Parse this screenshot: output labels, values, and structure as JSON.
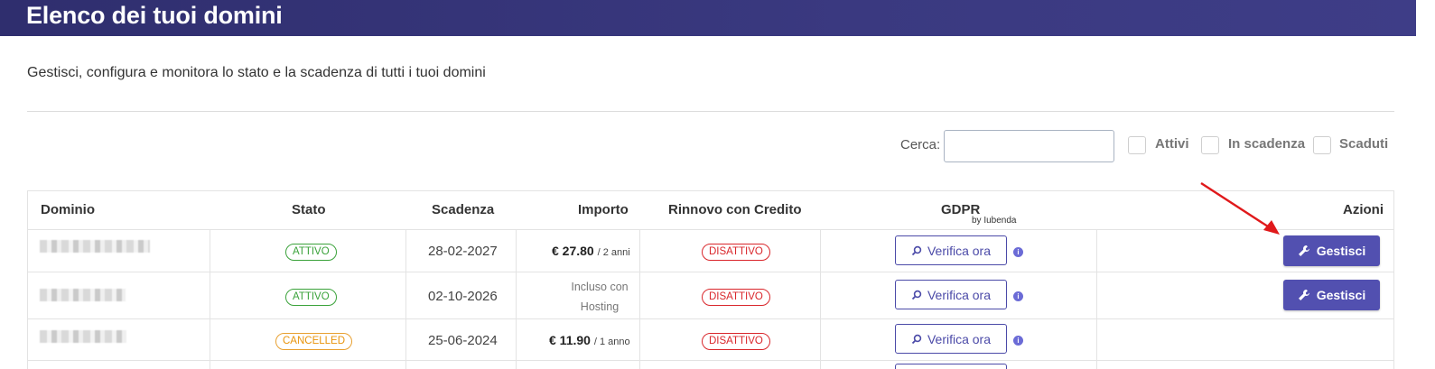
{
  "header": {
    "title": "Elenco dei tuoi domini"
  },
  "subtitle": "Gestisci, configura e monitora lo stato e la scadenza di tutti i tuoi domini",
  "filters": {
    "search_label": "Cerca:",
    "search_value": "",
    "checkboxes": [
      {
        "label": "Attivi",
        "checked": false
      },
      {
        "label": "In scadenza",
        "checked": false
      },
      {
        "label": "Scaduti",
        "checked": false
      }
    ]
  },
  "table": {
    "columns": [
      "Dominio",
      "Stato",
      "Scadenza",
      "Importo",
      "Rinnovo con Credito",
      "GDPR",
      "Azioni"
    ],
    "gdpr_sub": "by Iubenda",
    "rows": [
      {
        "status": "ATTIVO",
        "status_color": "#3aa23a",
        "expiry": "28-02-2027",
        "price": "€ 27.80",
        "period": "/ 2 anni",
        "renewal": "DISATTIVO",
        "gdpr_button": "Verifica ora",
        "action": "Gestisci"
      },
      {
        "status": "ATTIVO",
        "status_color": "#3aa23a",
        "expiry": "02-10-2026",
        "price_text": "Incluso con Hosting",
        "renewal": "DISATTIVO",
        "gdpr_button": "Verifica ora",
        "action": "Gestisci"
      },
      {
        "status": "CANCELLED",
        "status_color": "#e8940c",
        "expiry": "25-06-2024",
        "price": "€ 11.90",
        "period": "/ 1 anno",
        "renewal": "DISATTIVO",
        "gdpr_button": "Verifica ora",
        "action": ""
      }
    ]
  },
  "icons": {
    "search": "search-icon",
    "wrench": "wrench-icon",
    "info": "info-icon",
    "annotation": "red-arrow"
  },
  "colors": {
    "header": "#3a3980",
    "accent": "#5250b0",
    "active": "#3aa23a",
    "cancelled": "#e8940c",
    "disabled": "#d9262b"
  }
}
